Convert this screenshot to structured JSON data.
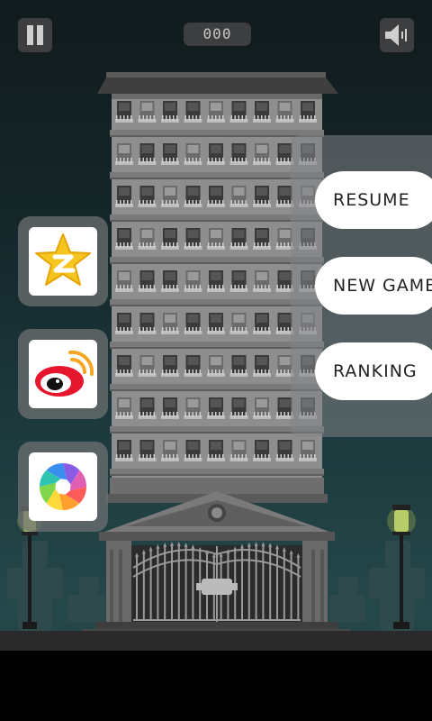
{
  "hud": {
    "score": "000",
    "pause_icon": "pause-icon",
    "sound_icon": "speaker-icon"
  },
  "menu": {
    "resume_label": "RESUME",
    "new_game_label": "NEW GAME",
    "ranking_label": "RANKING"
  },
  "share": [
    {
      "icon": "qzone-star-icon"
    },
    {
      "icon": "weibo-eye-icon"
    },
    {
      "icon": "moments-aperture-icon"
    }
  ],
  "colors": {
    "sky_top": "#111a1c",
    "sky_bottom": "#25484a",
    "building": "#8e8e8e",
    "button_bg": "#ffffff",
    "lamp_glow": "#c8e070"
  }
}
